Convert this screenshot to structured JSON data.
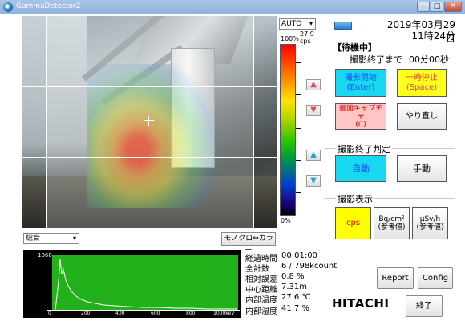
{
  "window": {
    "title": "GammaDetector2",
    "min": "–",
    "max": "□",
    "close": "✕"
  },
  "scale": {
    "mode": "AUTO",
    "max_value": "27.9",
    "unit": "cps",
    "top_label": "100%",
    "bottom_label": "0%"
  },
  "header": {
    "date": "2019年03月29日",
    "time": "11時24分",
    "status": "【待機中】",
    "remain_label": "撮影終了まで",
    "remain_value": "00分00秒"
  },
  "controls": {
    "start_line1": "撮影開始",
    "start_line2": "(Enter)",
    "pause_line1": "一時停止",
    "pause_line2": "(Space)",
    "capture_line1": "画面キャプチャ",
    "capture_line2": "(C)",
    "redo": "やり直し"
  },
  "judgement": {
    "group": "撮影終了判定",
    "auto": "自動",
    "manual": "手動"
  },
  "display": {
    "group": "撮影表示",
    "cps": "cps",
    "bq_line1": "Bq/cm²",
    "bq_line2": "(参考値)",
    "usv_line1": "µSv/h",
    "usv_line2": "(参考値)"
  },
  "bottom": {
    "combo": "総合",
    "mono_button": "モノクロ⇔カラー"
  },
  "spectrum": {
    "ymax": "1068",
    "ticks": [
      "0",
      "200",
      "400",
      "600",
      "800",
      "1000keV"
    ]
  },
  "stats": [
    {
      "label": "経過時間",
      "value": "00:01:00"
    },
    {
      "label": "全計数",
      "value": "6 / 798kcount"
    },
    {
      "label": "相対誤差",
      "value": "0.8 %"
    },
    {
      "label": "中心距離",
      "value": "7.31m"
    },
    {
      "label": "内部温度",
      "value": "27.6 ℃"
    },
    {
      "label": "内部湿度",
      "value": "41.7 %"
    }
  ],
  "footer": {
    "report": "Report",
    "config": "Config",
    "brand": "HITACHI",
    "exit": "終了"
  },
  "colors": {
    "start": "#17d8ee",
    "pause": "#ffff20",
    "capture": "#ffc6c6",
    "cps": "#ffff00",
    "spectrum_bg": "#22b11a"
  },
  "icons": {
    "app": "app-icon",
    "battery": "battery-icon",
    "up": "arrow-up-icon",
    "down": "arrow-down-icon"
  }
}
